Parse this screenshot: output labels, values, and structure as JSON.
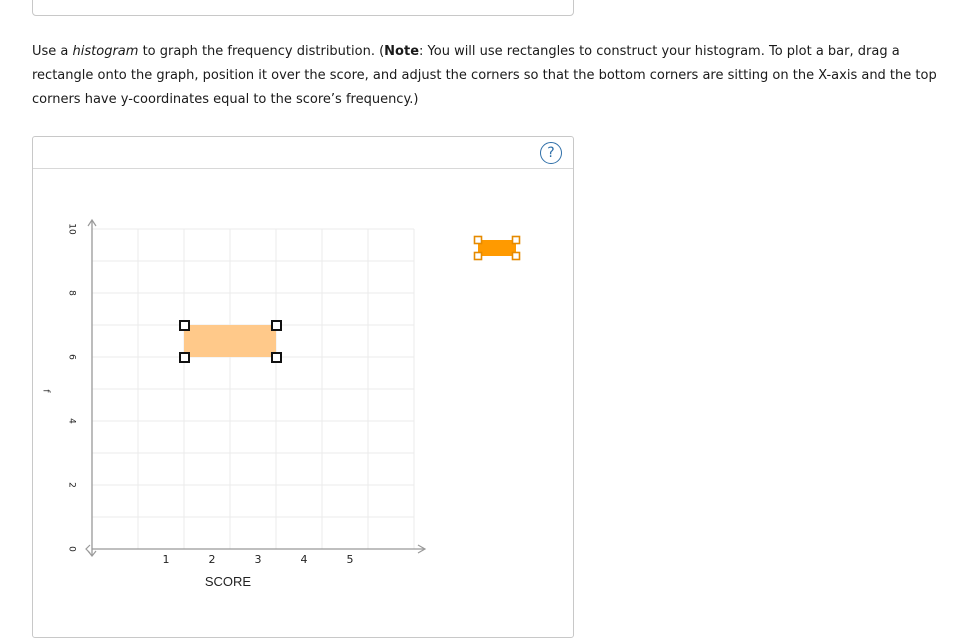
{
  "instructions": {
    "part1": "Use a ",
    "emph": "histogram",
    "part2": " to graph the frequency distribution. (",
    "note_label": "Note",
    "part3": ": You will use rectangles to construct your histogram. To plot a bar, drag a rectangle onto the graph, position it over the score, and adjust the corners so that the bottom corners are sitting on the X-axis and the top corners have y-coordinates equal to the score’s frequency.)"
  },
  "help_label": "?",
  "chart_data": {
    "type": "bar",
    "xlabel": "SCORE",
    "ylabel": "f",
    "x_ticks": [
      "1",
      "2",
      "3",
      "4",
      "5"
    ],
    "y_ticks": [
      "0",
      "2",
      "4",
      "6",
      "8",
      "10"
    ],
    "xlim": [
      0,
      7
    ],
    "ylim": [
      0,
      10
    ],
    "grid": true,
    "placed_rectangles": [
      {
        "x_start": 2,
        "x_end": 4,
        "y_bottom": 6,
        "y_top": 7
      }
    ],
    "colors": {
      "bar_fill": "#ffc98a",
      "tool_fill": "#ff9a00",
      "tool_stroke": "#e58a00",
      "grid": "#ebebeb",
      "axis": "#999999"
    }
  }
}
